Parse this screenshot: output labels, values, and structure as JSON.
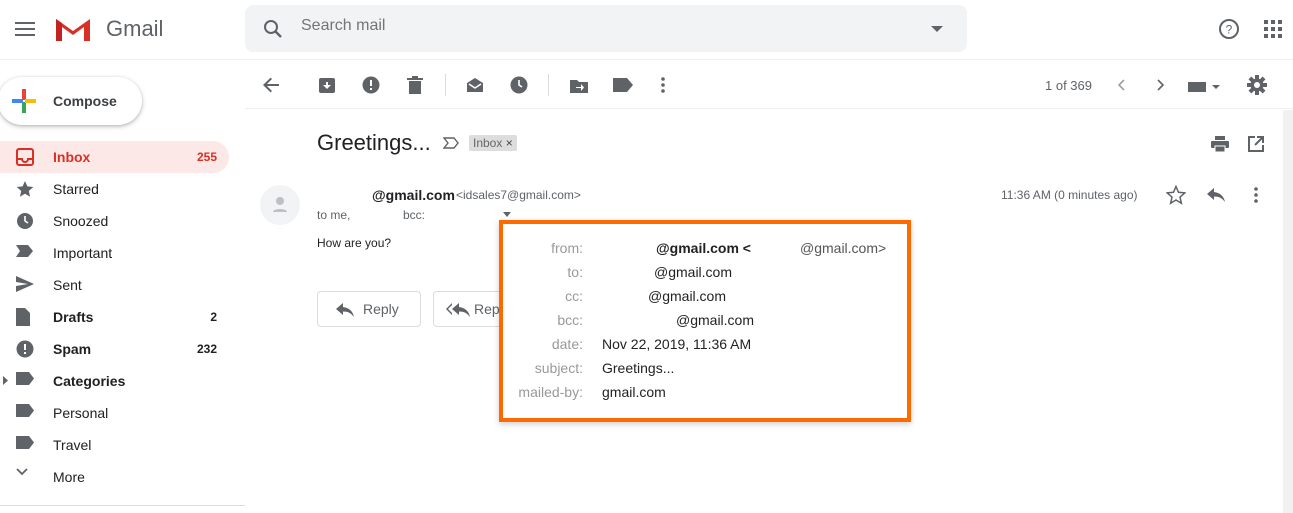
{
  "header": {
    "app_name": "Gmail",
    "search_placeholder": "Search mail"
  },
  "compose_label": "Compose",
  "sidebar": {
    "items": [
      {
        "label": "Inbox",
        "count": "255",
        "icon": "inbox-icon",
        "bold": true,
        "active": true
      },
      {
        "label": "Starred",
        "count": "",
        "icon": "star-icon"
      },
      {
        "label": "Snoozed",
        "count": "",
        "icon": "clock-icon"
      },
      {
        "label": "Important",
        "count": "",
        "icon": "important-icon"
      },
      {
        "label": "Sent",
        "count": "",
        "icon": "send-icon"
      },
      {
        "label": "Drafts",
        "count": "2",
        "icon": "draft-icon",
        "bold": true
      },
      {
        "label": "Spam",
        "count": "232",
        "icon": "spam-icon",
        "bold": true
      },
      {
        "label": "Categories",
        "count": "",
        "icon": "label-icon",
        "bold": true
      },
      {
        "label": "Personal",
        "count": "",
        "icon": "label-icon"
      },
      {
        "label": "Travel",
        "count": "",
        "icon": "label-icon"
      },
      {
        "label": "More",
        "count": "",
        "icon": "chevron-down-icon"
      }
    ]
  },
  "toolbar": {
    "pagination": "1 of 369"
  },
  "email": {
    "subject": "Greetings...",
    "label_badge": "Inbox",
    "sender_name": "@gmail.com",
    "sender_email": "<idsales7@gmail.com>",
    "recipients": "to me,",
    "recipients_bcc": "bcc:",
    "time": "11:36 AM (0 minutes ago)",
    "body": "How are you?",
    "reply_label": "Reply",
    "reply_all_label": "Rep"
  },
  "details_popup": {
    "rows": [
      {
        "key": "from:",
        "value": "@gmail.com <",
        "value2": "@gmail.com>"
      },
      {
        "key": "to:",
        "value": "@gmail.com"
      },
      {
        "key": "cc:",
        "value": "@gmail.com"
      },
      {
        "key": "bcc:",
        "value": "@gmail.com"
      },
      {
        "key": "date:",
        "value": "Nov 22, 2019, 11:36 AM"
      },
      {
        "key": "subject:",
        "value": "Greetings..."
      },
      {
        "key": "mailed-by:",
        "value": "gmail.com"
      }
    ],
    "highlight_color": "#ff6a00"
  }
}
